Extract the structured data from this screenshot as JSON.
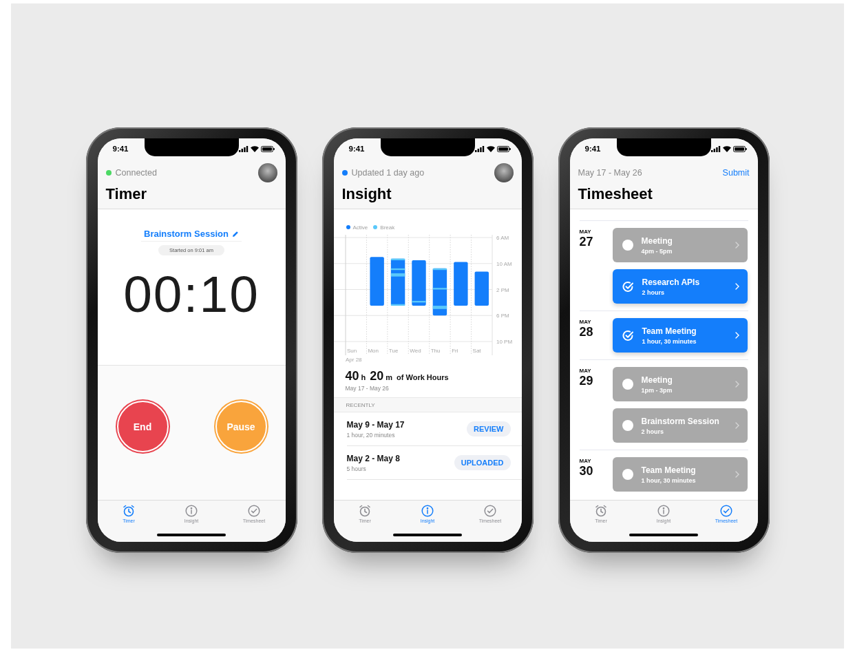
{
  "phones": [
    {
      "kind": "timer",
      "time": "9:41",
      "header": {
        "status": {
          "text": "Connected",
          "color": "#4cd964"
        },
        "avatar": true,
        "title": "Timer"
      },
      "session": {
        "name": "Brainstorm Session",
        "started": "Started on 9:01 am",
        "elapsed": "00:10"
      },
      "actions": [
        {
          "label": "End",
          "color": "#e8444f"
        },
        {
          "label": "Pause",
          "color": "#f9a43c"
        }
      ],
      "tabs": [
        {
          "label": "Timer",
          "kind": "alarm",
          "selected": true
        },
        {
          "label": "Insight",
          "kind": "info",
          "selected": false
        },
        {
          "label": "Timesheet",
          "kind": "check",
          "selected": false
        }
      ]
    },
    {
      "kind": "insight",
      "time": "9:41",
      "header": {
        "status": {
          "text": "Updated 1 day ago",
          "color": "#147efb"
        },
        "avatar": true,
        "title": "Insight"
      },
      "timeline": {
        "legend": [
          {
            "label": "Active",
            "color": "#147efb"
          },
          {
            "label": "Break",
            "color": "#5ac8fa"
          }
        ],
        "hour_labels": [
          "6 AM",
          "10 AM",
          "2 PM",
          "6 PM",
          "10 PM"
        ],
        "day_labels": [
          "Sun",
          "Mon",
          "Tue",
          "Wed",
          "Thu",
          "Fri",
          "Sat"
        ],
        "date_note": "Apr 28"
      },
      "summary": {
        "hours": "40",
        "hours_unit": "h",
        "minutes": "20",
        "minutes_unit": "m",
        "label": "of Work Hours",
        "range": "May 17 - May 26"
      },
      "section": "RECENTLY",
      "recent": [
        {
          "range": "May 9 - May 17",
          "duration": "1 hour, 20 minutes",
          "action": "REVIEW"
        },
        {
          "range": "May 2 - May 8",
          "duration": "5 hours",
          "action": "UPLOADED"
        }
      ],
      "tabs": [
        {
          "label": "Timer",
          "kind": "alarm",
          "selected": false
        },
        {
          "label": "Insight",
          "kind": "info",
          "selected": true
        },
        {
          "label": "Timesheet",
          "kind": "check",
          "selected": false
        }
      ]
    },
    {
      "kind": "timesheet",
      "time": "9:41",
      "header": {
        "range": "May 17 - May 26",
        "action": "Submit",
        "title": "Timesheet"
      },
      "days": [
        {
          "month": "MAY",
          "day": "27",
          "entries": [
            {
              "title": "Meeting",
              "detail": "4pm - 5pm",
              "checked": false
            },
            {
              "title": "Research APIs",
              "detail": "2 hours",
              "checked": true
            }
          ]
        },
        {
          "month": "MAY",
          "day": "28",
          "entries": [
            {
              "title": "Team Meeting",
              "detail": "1 hour, 30 minutes",
              "checked": true
            }
          ]
        },
        {
          "month": "MAY",
          "day": "29",
          "entries": [
            {
              "title": "Meeting",
              "detail": "1pm - 3pm",
              "checked": false
            },
            {
              "title": "Brainstorm Session",
              "detail": "2 hours",
              "checked": false
            }
          ]
        },
        {
          "month": "MAY",
          "day": "30",
          "entries": [
            {
              "title": "Team Meeting",
              "detail": "1 hour, 30 minutes",
              "checked": false
            }
          ]
        }
      ],
      "tabs": [
        {
          "label": "Timer",
          "kind": "alarm",
          "selected": false
        },
        {
          "label": "Insight",
          "kind": "info",
          "selected": false
        },
        {
          "label": "Timesheet",
          "kind": "check",
          "selected": true
        }
      ]
    }
  ]
}
